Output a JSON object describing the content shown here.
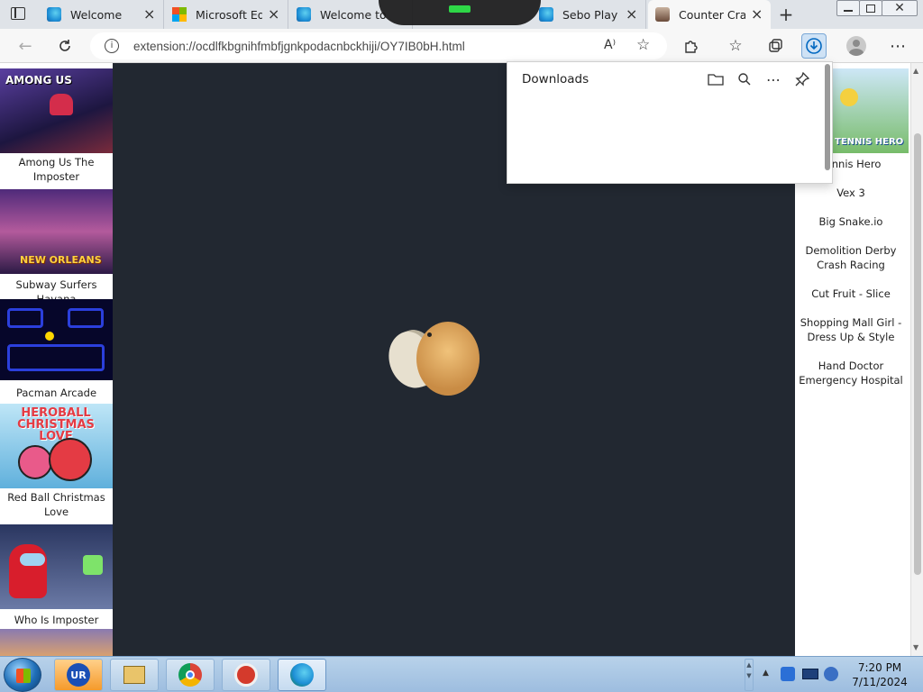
{
  "tabs": [
    {
      "label": "Welcome",
      "icon": "edge-icon",
      "color": "#1e8fd6"
    },
    {
      "label": "Microsoft Ed",
      "icon": "microsoft-logo-icon",
      "color": "#f25022"
    },
    {
      "label": "Welcome to",
      "icon": "edge-icon",
      "color": "#1e8fd6"
    },
    {
      "label": "Sebo Play Ga",
      "icon": "edge-icon",
      "color": "#1e8fd6"
    },
    {
      "label": "Counter Craf",
      "icon": "game-thumbnail-icon",
      "color": "#8a6a55"
    }
  ],
  "address": {
    "url": "extension://ocdlfkbgnihfmbfjgnkpodacnbckhiji/OY7IB0bH.html"
  },
  "downloads": {
    "title": "Downloads"
  },
  "left_games": [
    {
      "caption": "Among Us The Imposter",
      "thumb_text": "AMONG US",
      "color": "#3b2a6b"
    },
    {
      "caption": "Subway Surfers Havana",
      "thumb_text": "NEW ORLEANS",
      "color": "#8a4fb0"
    },
    {
      "caption": "Pacman Arcade",
      "thumb_text": "",
      "color": "#0a0a3a"
    },
    {
      "caption": "Red Ball Christmas Love",
      "thumb_text": "HEROBALL CHRISTMAS LOVE",
      "color": "#e43b44"
    },
    {
      "caption": "Who Is Imposter",
      "thumb_text": "",
      "color": "#3f4e7a"
    }
  ],
  "right_games": [
    {
      "caption": "Tennis Hero",
      "thumb_text": "TENNIS HERO"
    },
    {
      "caption": "Vex 3"
    },
    {
      "caption": "Big Snake.io"
    },
    {
      "caption": "Demolition Derby Crash Racing"
    },
    {
      "caption": "Cut Fruit - Slice"
    },
    {
      "caption": "Shopping Mall Girl - Dress Up & Style"
    },
    {
      "caption": "Hand Doctor Emergency Hospital"
    }
  ],
  "clock": {
    "time": "7:20 PM",
    "date": "7/11/2024"
  },
  "colors": {
    "page_bg": "#222831",
    "accent": "#0067c0"
  }
}
